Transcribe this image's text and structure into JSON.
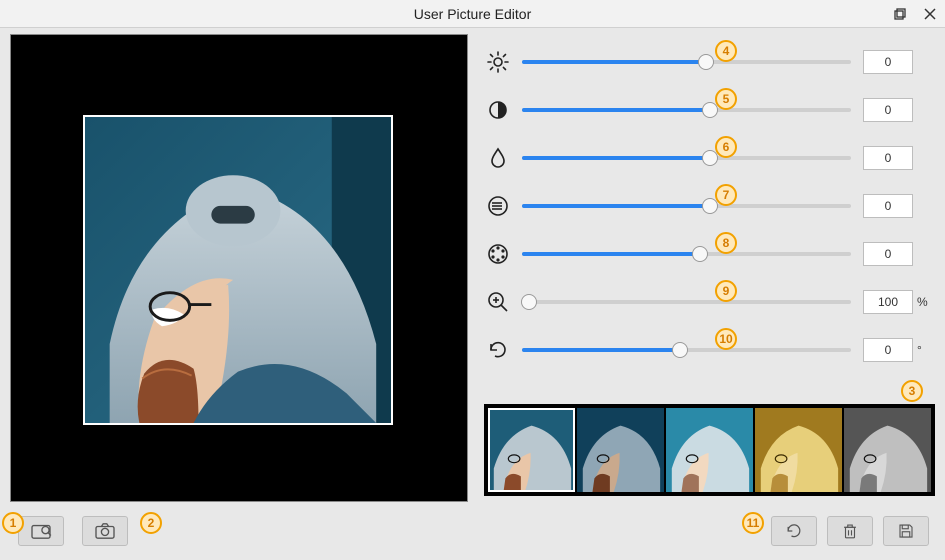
{
  "window": {
    "title": "User Picture Editor"
  },
  "sliders": {
    "brightness": {
      "value": 0,
      "fill": 56
    },
    "contrast": {
      "value": 0,
      "fill": 57
    },
    "saturation": {
      "value": 0,
      "fill": 57
    },
    "detail": {
      "value": 0,
      "fill": 57
    },
    "color": {
      "value": 0,
      "fill": 54
    },
    "zoom": {
      "value": 100,
      "fill": 2,
      "unit": "%"
    },
    "rotation": {
      "value": 0,
      "fill": 48,
      "unit": "°"
    }
  },
  "filters": {
    "items": [
      {
        "id": "original",
        "selected": true
      },
      {
        "id": "cool"
      },
      {
        "id": "cyan"
      },
      {
        "id": "sepia"
      },
      {
        "id": "grayscale"
      }
    ]
  },
  "annotations": {
    "a1": "1",
    "a2": "2",
    "a3": "3",
    "a4": "4",
    "a5": "5",
    "a6": "6",
    "a7": "7",
    "a8": "8",
    "a9": "9",
    "a10": "10",
    "a11": "11"
  }
}
